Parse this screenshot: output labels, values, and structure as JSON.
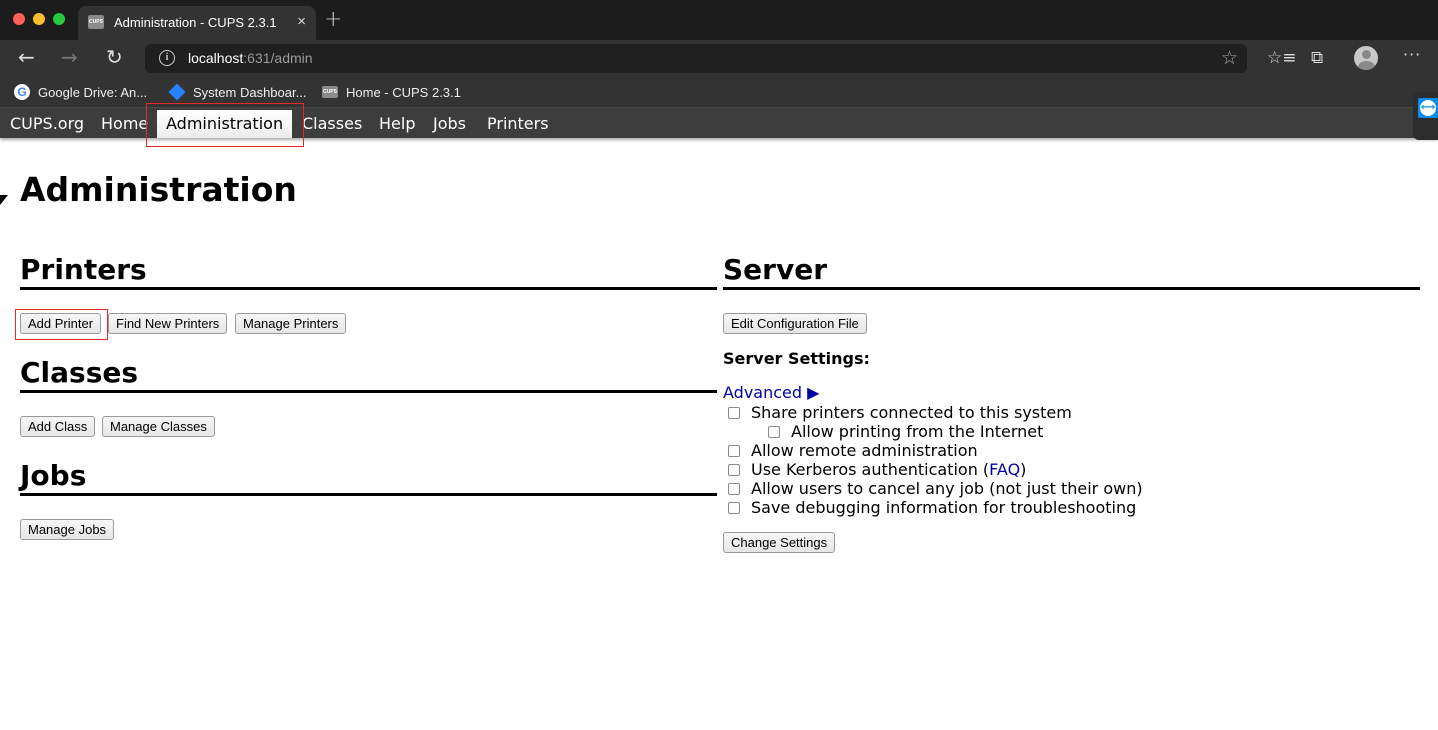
{
  "browser": {
    "tab": {
      "favicon": "CUPS",
      "title": "Administration - CUPS 2.3.1",
      "close": "×"
    },
    "new_tab": "+",
    "nav": {
      "back": "←",
      "forward": "→",
      "reload": "↻"
    },
    "address": {
      "host": "localhost",
      "rest": ":631/admin",
      "info": "i",
      "star": "☆"
    },
    "toolbar_icons": {
      "favorites": "☆≡",
      "collections": "⧉",
      "more": "···"
    },
    "bookmarks": [
      {
        "icon": "G",
        "label": "Google Drive: An..."
      },
      {
        "icon": "",
        "label": "System Dashboar..."
      },
      {
        "icon": "CUPS",
        "label": "Home - CUPS 2.3.1"
      }
    ]
  },
  "cups_nav": {
    "items": [
      "CUPS.org",
      "Home",
      "Administration",
      "Classes",
      "Help",
      "Jobs",
      "Printers"
    ],
    "active": "Administration"
  },
  "page": {
    "title": "Administration",
    "printers": {
      "heading": "Printers",
      "buttons": [
        "Add Printer",
        "Find New Printers",
        "Manage Printers"
      ]
    },
    "classes": {
      "heading": "Classes",
      "buttons": [
        "Add Class",
        "Manage Classes"
      ]
    },
    "jobs": {
      "heading": "Jobs",
      "buttons": [
        "Manage Jobs"
      ]
    },
    "server": {
      "heading": "Server",
      "edit_button": "Edit Configuration File",
      "settings_label": "Server Settings:",
      "advanced_link": "Advanced ▶",
      "options": [
        {
          "label": "Share printers connected to this system",
          "checked": false
        },
        {
          "label": "Allow printing from the Internet",
          "checked": false
        },
        {
          "label": "Allow remote administration",
          "checked": false
        },
        {
          "label": "Use Kerberos authentication (",
          "link": "FAQ",
          "suffix": ")",
          "checked": false
        },
        {
          "label": "Allow users to cancel any job (not just their own)",
          "checked": false
        },
        {
          "label": "Save debugging information for troubleshooting",
          "checked": false
        }
      ],
      "change_button": "Change Settings"
    }
  }
}
